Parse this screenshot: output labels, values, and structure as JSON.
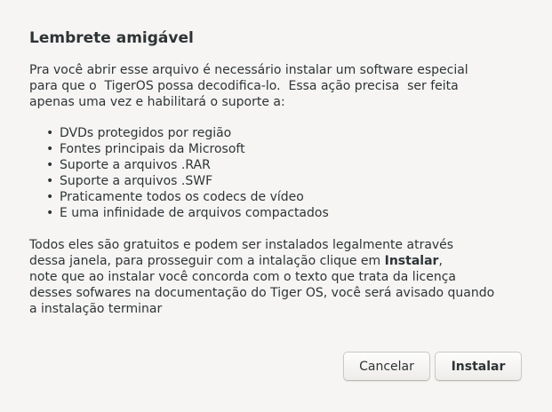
{
  "dialog": {
    "title": "Lembrete amigável",
    "intro_lines": [
      "Pra você abrir esse arquivo é necessário instalar um software especial",
      "para que o  TigerOS possa decodifica-lo.  Essa ação precisa  ser feita",
      "apenas uma vez e habilitará o suporte a:"
    ],
    "features": [
      "DVDs protegidos por região",
      "Fontes principais da Microsoft",
      "Suporte a arquivos .RAR",
      "Suporte a arquivos .SWF",
      "Praticamente todos os codecs de vídeo",
      "E uma infinidade de arquivos compactados"
    ],
    "bullet": "•",
    "outro": {
      "line1": "Todos eles são gratuitos e podem ser instalados legalmente através",
      "line2_before": "dessa janela, para prosseguir com a intalação clique em ",
      "line2_bold": "Instalar",
      "line2_after": ",",
      "line3": "note que ao instalar você concorda com o texto que trata da licença",
      "line4": "desses sofwares na documentação do Tiger OS, você será avisado quando",
      "line5": "a instalação terminar"
    }
  },
  "buttons": {
    "cancel_label": "Cancelar",
    "install_label": "Instalar"
  }
}
